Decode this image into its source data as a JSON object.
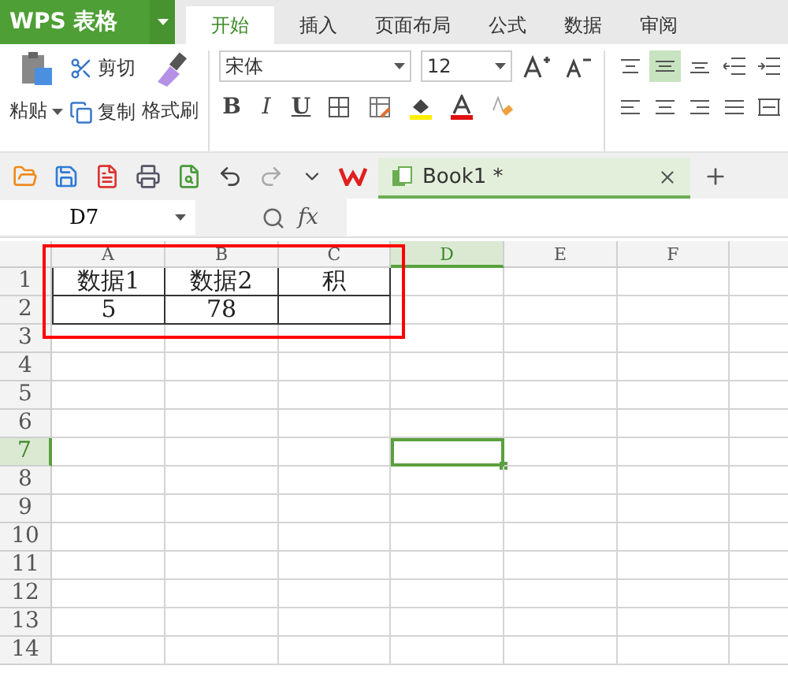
{
  "app_menu": {
    "label": "WPS 表格"
  },
  "tabs": [
    {
      "label": "开始",
      "selected": true
    },
    {
      "label": "插入",
      "selected": false
    },
    {
      "label": "页面布局",
      "selected": false
    },
    {
      "label": "公式",
      "selected": false
    },
    {
      "label": "数据",
      "selected": false
    },
    {
      "label": "审阅",
      "selected": false
    }
  ],
  "clipboard": {
    "paste": "粘贴",
    "cut": "剪切",
    "copy": "复制",
    "format_painter": "格式刷"
  },
  "font": {
    "name": "宋体",
    "size": "12",
    "bold": "B",
    "italic": "I",
    "underline": "U"
  },
  "document_tabs": [
    {
      "label": "Book1 *",
      "selected": true
    }
  ],
  "name_box": "D7",
  "formula_label": "fx",
  "columns": [
    {
      "label": "A",
      "selected": false
    },
    {
      "label": "B",
      "selected": false
    },
    {
      "label": "C",
      "selected": false
    },
    {
      "label": "D",
      "selected": true
    },
    {
      "label": "E",
      "selected": false
    },
    {
      "label": "F",
      "selected": false
    },
    {
      "selected": false
    }
  ],
  "rows": [
    {
      "label": "1",
      "selected": false,
      "bordered": true,
      "cells": [
        "数据1",
        "数据2",
        "积"
      ]
    },
    {
      "label": "2",
      "selected": false,
      "bordered": true,
      "cells": [
        "5",
        "78"
      ]
    },
    {
      "label": "3",
      "selected": false,
      "bordered": false
    },
    {
      "label": "4",
      "selected": false,
      "bordered": false
    },
    {
      "label": "5",
      "selected": false,
      "bordered": false
    },
    {
      "label": "6",
      "selected": false,
      "bordered": false
    },
    {
      "label": "7",
      "selected": true,
      "bordered": false
    },
    {
      "label": "8",
      "selected": false,
      "bordered": false
    },
    {
      "label": "9",
      "selected": false,
      "bordered": false
    },
    {
      "label": "10",
      "selected": false,
      "bordered": false
    },
    {
      "label": "11",
      "selected": false,
      "bordered": false
    },
    {
      "label": "12",
      "selected": false,
      "bordered": false
    },
    {
      "label": "13",
      "selected": false,
      "bordered": false
    },
    {
      "label": "14",
      "selected": false,
      "bordered": false
    }
  ],
  "annotations": [
    {
      "kind": "rectangle",
      "color": "#ff0000"
    }
  ]
}
